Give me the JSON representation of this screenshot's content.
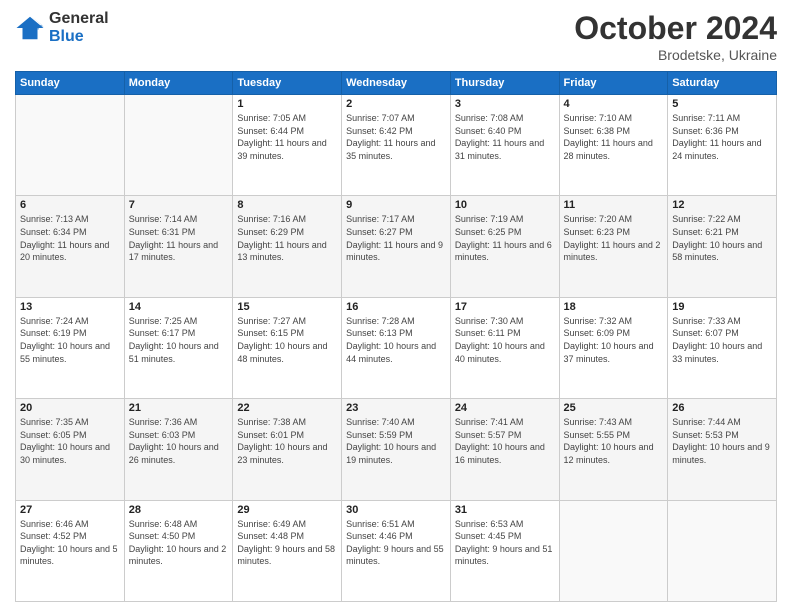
{
  "header": {
    "logo_general": "General",
    "logo_blue": "Blue",
    "title": "October 2024",
    "location": "Brodetske, Ukraine"
  },
  "weekdays": [
    "Sunday",
    "Monday",
    "Tuesday",
    "Wednesday",
    "Thursday",
    "Friday",
    "Saturday"
  ],
  "weeks": [
    {
      "shaded": false,
      "days": [
        {
          "num": "",
          "sunrise": "",
          "sunset": "",
          "daylight": ""
        },
        {
          "num": "",
          "sunrise": "",
          "sunset": "",
          "daylight": ""
        },
        {
          "num": "1",
          "sunrise": "Sunrise: 7:05 AM",
          "sunset": "Sunset: 6:44 PM",
          "daylight": "Daylight: 11 hours and 39 minutes."
        },
        {
          "num": "2",
          "sunrise": "Sunrise: 7:07 AM",
          "sunset": "Sunset: 6:42 PM",
          "daylight": "Daylight: 11 hours and 35 minutes."
        },
        {
          "num": "3",
          "sunrise": "Sunrise: 7:08 AM",
          "sunset": "Sunset: 6:40 PM",
          "daylight": "Daylight: 11 hours and 31 minutes."
        },
        {
          "num": "4",
          "sunrise": "Sunrise: 7:10 AM",
          "sunset": "Sunset: 6:38 PM",
          "daylight": "Daylight: 11 hours and 28 minutes."
        },
        {
          "num": "5",
          "sunrise": "Sunrise: 7:11 AM",
          "sunset": "Sunset: 6:36 PM",
          "daylight": "Daylight: 11 hours and 24 minutes."
        }
      ]
    },
    {
      "shaded": true,
      "days": [
        {
          "num": "6",
          "sunrise": "Sunrise: 7:13 AM",
          "sunset": "Sunset: 6:34 PM",
          "daylight": "Daylight: 11 hours and 20 minutes."
        },
        {
          "num": "7",
          "sunrise": "Sunrise: 7:14 AM",
          "sunset": "Sunset: 6:31 PM",
          "daylight": "Daylight: 11 hours and 17 minutes."
        },
        {
          "num": "8",
          "sunrise": "Sunrise: 7:16 AM",
          "sunset": "Sunset: 6:29 PM",
          "daylight": "Daylight: 11 hours and 13 minutes."
        },
        {
          "num": "9",
          "sunrise": "Sunrise: 7:17 AM",
          "sunset": "Sunset: 6:27 PM",
          "daylight": "Daylight: 11 hours and 9 minutes."
        },
        {
          "num": "10",
          "sunrise": "Sunrise: 7:19 AM",
          "sunset": "Sunset: 6:25 PM",
          "daylight": "Daylight: 11 hours and 6 minutes."
        },
        {
          "num": "11",
          "sunrise": "Sunrise: 7:20 AM",
          "sunset": "Sunset: 6:23 PM",
          "daylight": "Daylight: 11 hours and 2 minutes."
        },
        {
          "num": "12",
          "sunrise": "Sunrise: 7:22 AM",
          "sunset": "Sunset: 6:21 PM",
          "daylight": "Daylight: 10 hours and 58 minutes."
        }
      ]
    },
    {
      "shaded": false,
      "days": [
        {
          "num": "13",
          "sunrise": "Sunrise: 7:24 AM",
          "sunset": "Sunset: 6:19 PM",
          "daylight": "Daylight: 10 hours and 55 minutes."
        },
        {
          "num": "14",
          "sunrise": "Sunrise: 7:25 AM",
          "sunset": "Sunset: 6:17 PM",
          "daylight": "Daylight: 10 hours and 51 minutes."
        },
        {
          "num": "15",
          "sunrise": "Sunrise: 7:27 AM",
          "sunset": "Sunset: 6:15 PM",
          "daylight": "Daylight: 10 hours and 48 minutes."
        },
        {
          "num": "16",
          "sunrise": "Sunrise: 7:28 AM",
          "sunset": "Sunset: 6:13 PM",
          "daylight": "Daylight: 10 hours and 44 minutes."
        },
        {
          "num": "17",
          "sunrise": "Sunrise: 7:30 AM",
          "sunset": "Sunset: 6:11 PM",
          "daylight": "Daylight: 10 hours and 40 minutes."
        },
        {
          "num": "18",
          "sunrise": "Sunrise: 7:32 AM",
          "sunset": "Sunset: 6:09 PM",
          "daylight": "Daylight: 10 hours and 37 minutes."
        },
        {
          "num": "19",
          "sunrise": "Sunrise: 7:33 AM",
          "sunset": "Sunset: 6:07 PM",
          "daylight": "Daylight: 10 hours and 33 minutes."
        }
      ]
    },
    {
      "shaded": true,
      "days": [
        {
          "num": "20",
          "sunrise": "Sunrise: 7:35 AM",
          "sunset": "Sunset: 6:05 PM",
          "daylight": "Daylight: 10 hours and 30 minutes."
        },
        {
          "num": "21",
          "sunrise": "Sunrise: 7:36 AM",
          "sunset": "Sunset: 6:03 PM",
          "daylight": "Daylight: 10 hours and 26 minutes."
        },
        {
          "num": "22",
          "sunrise": "Sunrise: 7:38 AM",
          "sunset": "Sunset: 6:01 PM",
          "daylight": "Daylight: 10 hours and 23 minutes."
        },
        {
          "num": "23",
          "sunrise": "Sunrise: 7:40 AM",
          "sunset": "Sunset: 5:59 PM",
          "daylight": "Daylight: 10 hours and 19 minutes."
        },
        {
          "num": "24",
          "sunrise": "Sunrise: 7:41 AM",
          "sunset": "Sunset: 5:57 PM",
          "daylight": "Daylight: 10 hours and 16 minutes."
        },
        {
          "num": "25",
          "sunrise": "Sunrise: 7:43 AM",
          "sunset": "Sunset: 5:55 PM",
          "daylight": "Daylight: 10 hours and 12 minutes."
        },
        {
          "num": "26",
          "sunrise": "Sunrise: 7:44 AM",
          "sunset": "Sunset: 5:53 PM",
          "daylight": "Daylight: 10 hours and 9 minutes."
        }
      ]
    },
    {
      "shaded": false,
      "days": [
        {
          "num": "27",
          "sunrise": "Sunrise: 6:46 AM",
          "sunset": "Sunset: 4:52 PM",
          "daylight": "Daylight: 10 hours and 5 minutes."
        },
        {
          "num": "28",
          "sunrise": "Sunrise: 6:48 AM",
          "sunset": "Sunset: 4:50 PM",
          "daylight": "Daylight: 10 hours and 2 minutes."
        },
        {
          "num": "29",
          "sunrise": "Sunrise: 6:49 AM",
          "sunset": "Sunset: 4:48 PM",
          "daylight": "Daylight: 9 hours and 58 minutes."
        },
        {
          "num": "30",
          "sunrise": "Sunrise: 6:51 AM",
          "sunset": "Sunset: 4:46 PM",
          "daylight": "Daylight: 9 hours and 55 minutes."
        },
        {
          "num": "31",
          "sunrise": "Sunrise: 6:53 AM",
          "sunset": "Sunset: 4:45 PM",
          "daylight": "Daylight: 9 hours and 51 minutes."
        },
        {
          "num": "",
          "sunrise": "",
          "sunset": "",
          "daylight": ""
        },
        {
          "num": "",
          "sunrise": "",
          "sunset": "",
          "daylight": ""
        }
      ]
    }
  ]
}
